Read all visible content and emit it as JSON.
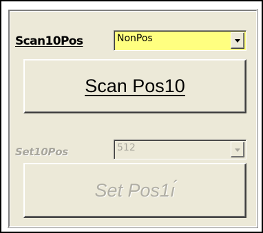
{
  "scan_row": {
    "label": "Scan10Pos",
    "combo_value": "NonPos",
    "combo_bg_color": "#ffff80"
  },
  "scan_button": {
    "label": "Scan Pos10"
  },
  "set_row": {
    "label": "Set10Pos",
    "combo_value": "512",
    "enabled": false
  },
  "set_button": {
    "label": "Set Pos1ı́",
    "enabled": false
  },
  "icons": {
    "dropdown": "chevron-down-icon"
  },
  "colors": {
    "panel": "#ece9d8",
    "disabled_text": "#a8a69c",
    "frame": "#000000"
  }
}
